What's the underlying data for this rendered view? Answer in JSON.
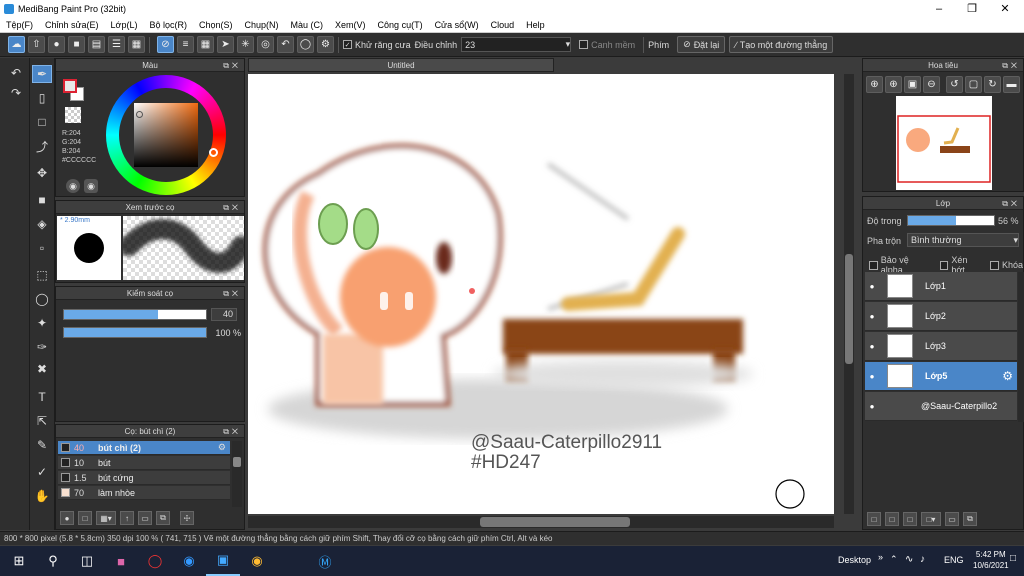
{
  "window": {
    "title": "MediBang Paint Pro (32bit)"
  },
  "menu": [
    "Tệp(F)",
    "Chỉnh sửa(E)",
    "Lớp(L)",
    "Bộ lọc(R)",
    "Chọn(S)",
    "Chụp(N)",
    "Màu (C)",
    "Xem(V)",
    "Công cụ(T)",
    "Cửa sổ(W)",
    "Cloud",
    "Help"
  ],
  "toolopts": {
    "antialias_label": "Khử răng cưa",
    "correction_label": "Điều chỉnh",
    "correction_value": "23",
    "smooth_label": "Canh mềm",
    "key_label": "Phím",
    "reset_label": "Đặt lại",
    "straight_label": "Tạo một đường thẳng"
  },
  "color_panel": {
    "title": "Màu",
    "r": "R:204",
    "g": "G:204",
    "b": "B:204",
    "hex": "#CCCCCC",
    "accent": "#4a86c8"
  },
  "brush_preview": {
    "title": "Xem trước cọ",
    "size": "2.90mm"
  },
  "brush_control": {
    "title": "Kiểm soát cọ",
    "size_value": "40",
    "opacity_value": "100 %",
    "size_fraction": 0.66,
    "opacity_fraction": 1.0
  },
  "brush_list": {
    "title": "Cọ: bút chì (2)",
    "items": [
      {
        "size": "40",
        "name": "bút chì (2)"
      },
      {
        "size": "10",
        "name": "bút"
      },
      {
        "size": "1.5",
        "name": "bút cứng"
      },
      {
        "size": "70",
        "name": "làm nhòe"
      }
    ]
  },
  "document": {
    "tab": "Untitled",
    "credit": "@Saau-Caterpillo2911",
    "tag": "#HD247"
  },
  "navigator": {
    "title": "Hoa tiêu"
  },
  "layers": {
    "title": "Lớp",
    "opacity_label": "Độ trong",
    "opacity_value": "56 %",
    "opacity_fraction": 0.56,
    "blend_label": "Pha trộn",
    "blend_value": "Bình thường",
    "protect_alpha": "Bảo vệ alpha",
    "clip": "Xén bớt",
    "lock": "Khóa",
    "items": [
      "Lớp1",
      "Lớp2",
      "Lớp3",
      "Lớp5",
      "@Saau-Caterpillo2"
    ]
  },
  "status": {
    "text": "800 * 800 pixel  (5.8 * 5.8cm)  350 dpi  100 %  ( 741, 715 )  Vẽ một đường thẳng bằng cách giữ phím Shift, Thay đổi cỡ cọ bằng cách giữ phím Ctrl, Alt và kéo"
  },
  "taskbar": {
    "desktop": "Desktop",
    "lang": "ENG",
    "time": "5:42 PM",
    "date": "10/6/2021"
  }
}
